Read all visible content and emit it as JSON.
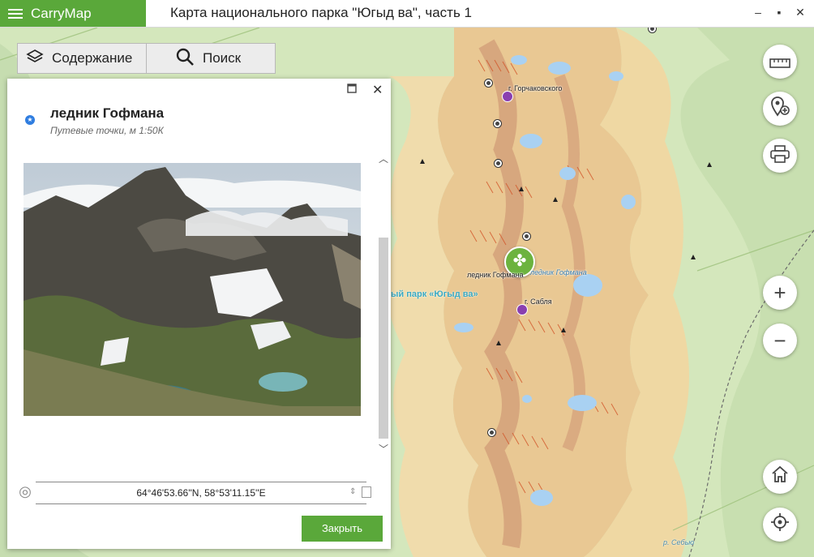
{
  "app": {
    "name": "CarryMap"
  },
  "window": {
    "title": "Карта национального парка \"Югыд ва\", часть 1"
  },
  "toolbar": {
    "contents_label": "Содержание",
    "search_label": "Поиск"
  },
  "map": {
    "labels": {
      "peak1": "г. Горчаковского",
      "peak2": "г. Сабля",
      "glacier_left": "ледник Гофмана",
      "glacier_right": "ледник Гофмана",
      "park": "ый парк «Югыд ва»",
      "river": "р. Себью"
    }
  },
  "panel": {
    "title": "ледник Гофмана",
    "subtitle": "Путевые точки, м 1:50К",
    "coordinates": "64°46'53.66''N, 58°53'11.15''E",
    "close_label": "Закрыть"
  },
  "icons": {
    "menu": "hamburger-icon",
    "contents": "layers-icon",
    "search": "search-icon",
    "ruler": "ruler-icon",
    "add_place": "add-location-icon",
    "print": "printer-icon",
    "zoom_in": "plus-icon",
    "zoom_out": "minus-icon",
    "home": "home-icon",
    "locate": "crosshair-icon"
  },
  "colors": {
    "brand": "#5aa83a",
    "panel_bg": "#ffffff",
    "map_green": "#d4e7bc",
    "mountain": "#e7c48f"
  }
}
